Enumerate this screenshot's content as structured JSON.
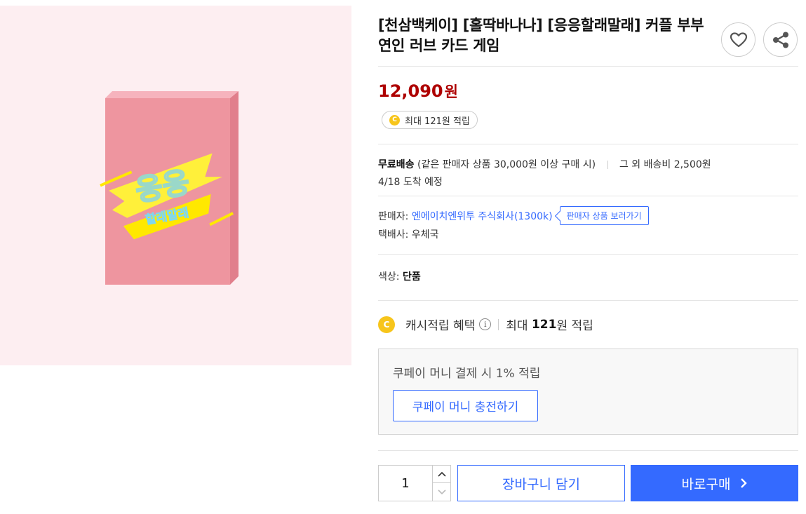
{
  "product": {
    "title": "[천삼백케이] [홀딱바나나] [응응할래말래] 커플 부부 연인 러브 카드 게임",
    "image": {
      "logo_main": "응응",
      "logo_sub": "할래말래"
    },
    "price": {
      "amount": "12,090",
      "unit": "원",
      "color": "#ae0000"
    },
    "reward_pill": {
      "coin": "C",
      "text": "최대 121원 적립"
    }
  },
  "actions": {
    "wish_icon": "heart-icon",
    "share_icon": "share-icon"
  },
  "shipping": {
    "label": "무료배송",
    "condition": "(같은 판매자 상품 30,000원 이상 구매 시)",
    "extra": "그 외 배송비 2,500원",
    "eta": "4/18 도착 예정"
  },
  "seller": {
    "label": "판매자:",
    "name": "엔에이치엔위투 주식회사(1300k)",
    "tag": "판매자 상품 보러가기",
    "courier": "택배사: 우체국"
  },
  "option": {
    "label": "색상:",
    "value": "단품"
  },
  "cash": {
    "coin": "C",
    "label": "캐시적립 혜택",
    "info_icon": "i",
    "max_prefix": "최대",
    "max_amount": "121",
    "max_suffix": "원 적립"
  },
  "coupay": {
    "text": "쿠페이 머니 결제 시 1% 적립",
    "button": "쿠페이 머니 충전하기"
  },
  "purchase": {
    "quantity": "1",
    "cart": "장바구니 담기",
    "buy": "바로구매"
  },
  "colors": {
    "accent": "#346aff",
    "coin": "#f7c51b",
    "image_bg": "#fdeef1",
    "box_pink": "#ee959f"
  }
}
